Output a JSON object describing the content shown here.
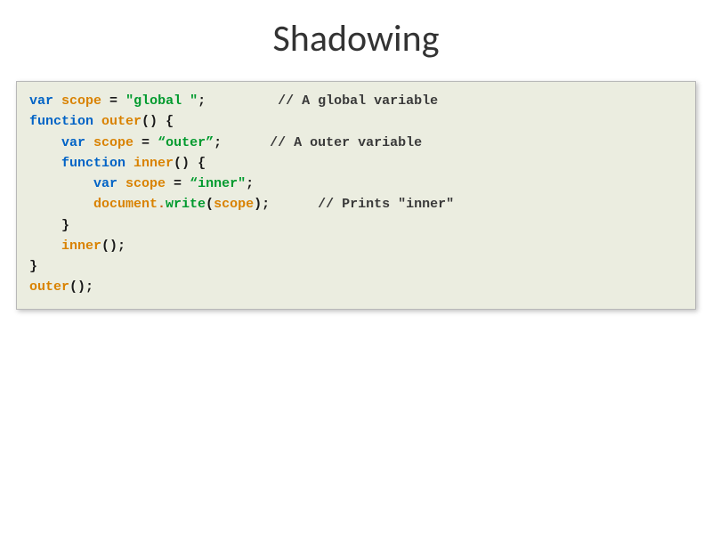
{
  "title": "Shadowing",
  "code": {
    "kw_var": "var",
    "kw_function": "function",
    "id_scope": "scope",
    "id_outer": "outer",
    "id_inner": "inner",
    "id_document": "document",
    "id_write": "write",
    "eq": " = ",
    "paren_open": "(",
    "paren_close": ")",
    "brace_open": " {",
    "brace_close": "}",
    "semi": ";",
    "dot": ".",
    "empty_parens": "()",
    "str_global": "\"global \"",
    "str_outer": "“outer”",
    "str_inner": "“inner\"",
    "gap1": "         ",
    "gap2": "      ",
    "gap3": "      ",
    "cmt_global": "// A global variable",
    "cmt_outer": "// A outer variable",
    "cmt_inner": "// Prints \"inner\""
  }
}
